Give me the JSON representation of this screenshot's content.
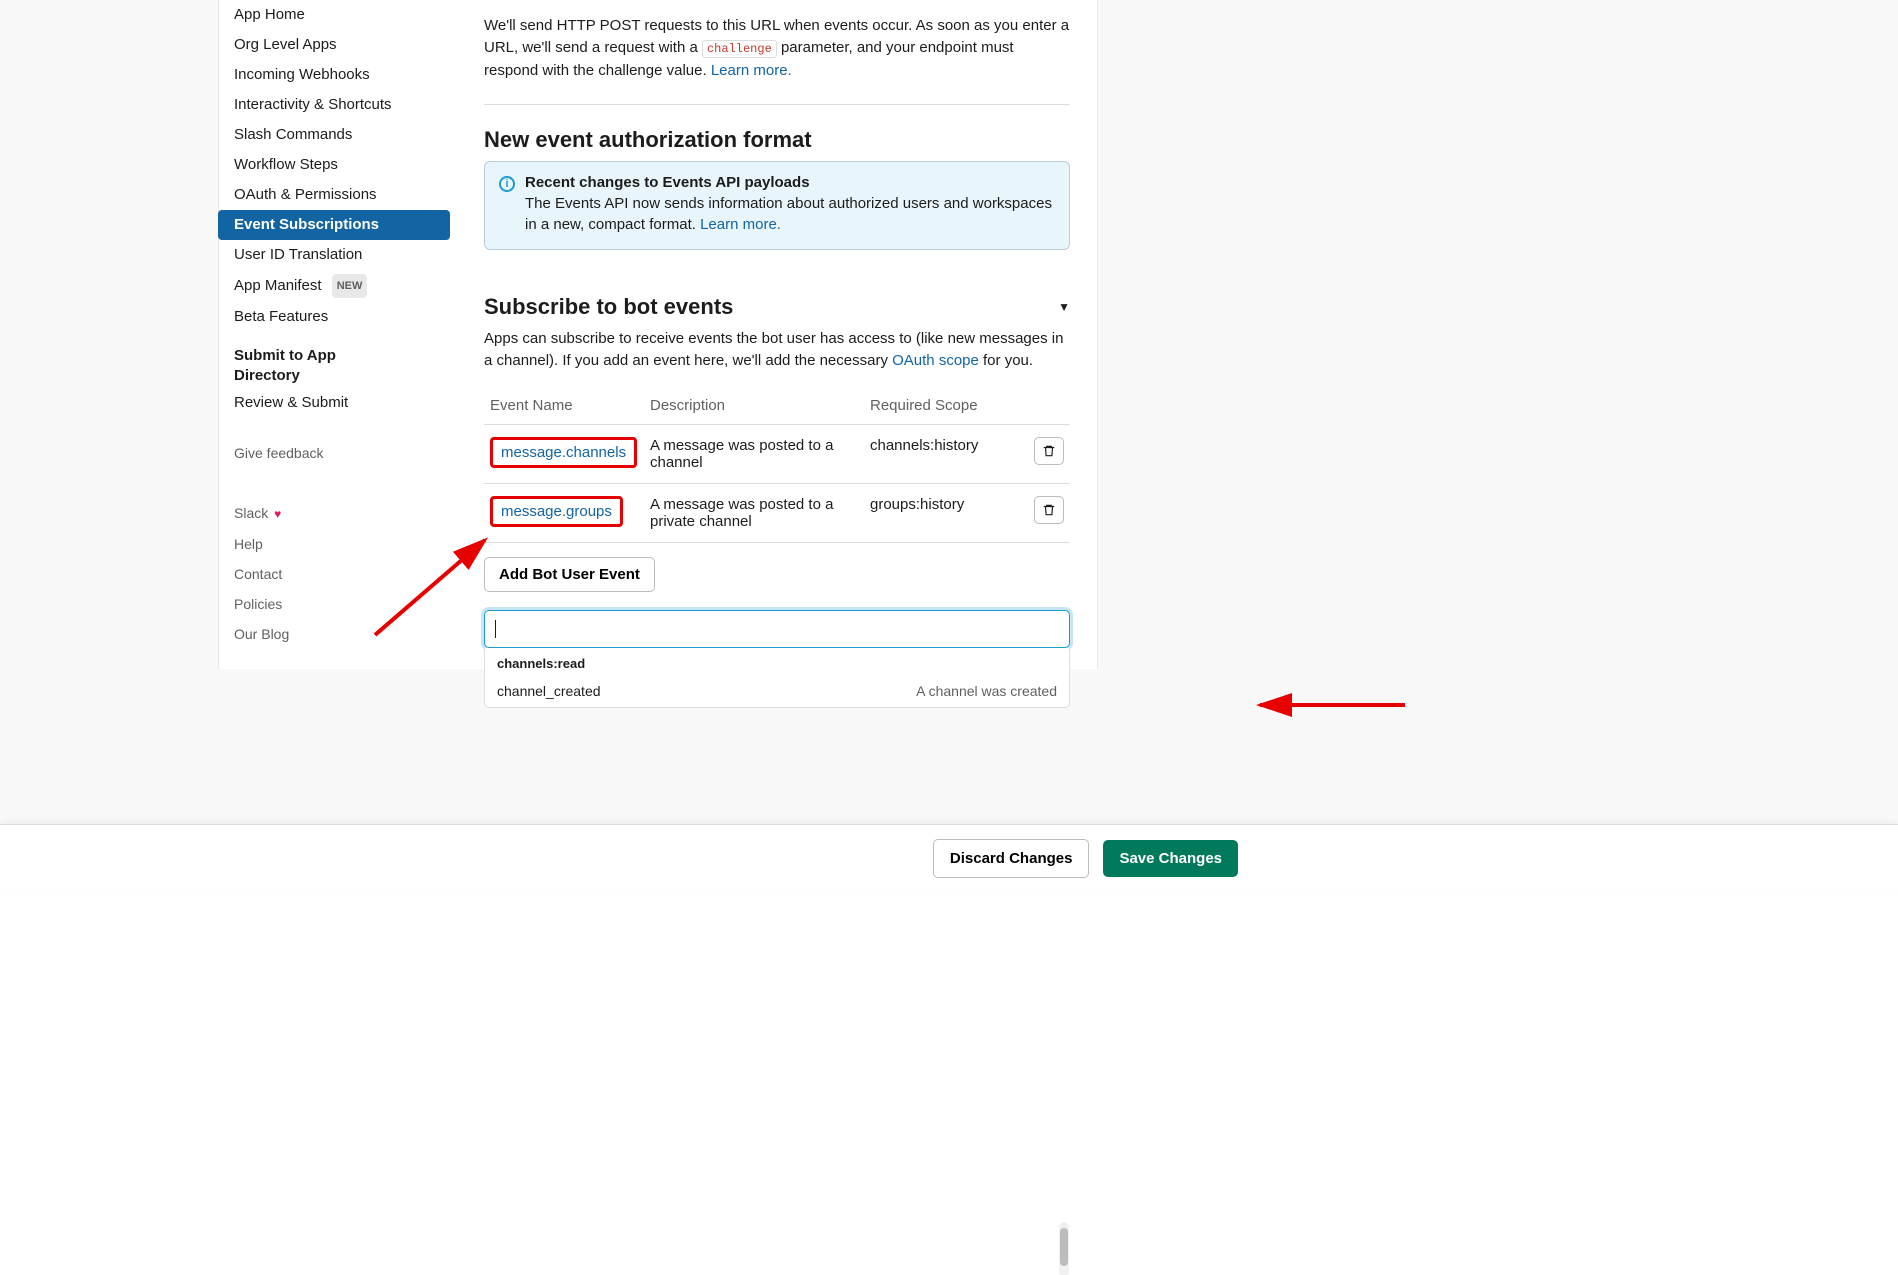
{
  "sidebar": {
    "items": [
      {
        "label": "App Home"
      },
      {
        "label": "Org Level Apps"
      },
      {
        "label": "Incoming Webhooks"
      },
      {
        "label": "Interactivity & Shortcuts"
      },
      {
        "label": "Slash Commands"
      },
      {
        "label": "Workflow Steps"
      },
      {
        "label": "OAuth & Permissions"
      },
      {
        "label": "Event Subscriptions"
      },
      {
        "label": "User ID Translation"
      },
      {
        "label": "App Manifest"
      },
      {
        "label": "Beta Features"
      }
    ],
    "new_badge": "NEW",
    "submit_title_line1": "Submit to App",
    "submit_title_line2": "Directory",
    "review_label": "Review & Submit",
    "feedback_label": "Give feedback",
    "footer": [
      {
        "label": "Slack"
      },
      {
        "label": "Help"
      },
      {
        "label": "Contact"
      },
      {
        "label": "Policies"
      },
      {
        "label": "Our Blog"
      }
    ]
  },
  "main": {
    "intro_pre": "We'll send HTTP POST requests to this URL when events occur. As soon as you enter a URL, we'll send a request with a ",
    "intro_code": "challenge",
    "intro_post": " parameter, and your endpoint must respond with the challenge value. ",
    "learn_more": "Learn more",
    "auth_title": "New event authorization format",
    "info_title": "Recent changes to Events API payloads",
    "info_body": "The Events API now sends information about authorized users and workspaces in a new, compact format. ",
    "info_link": "Learn more.",
    "subscribe_title": "Subscribe to bot events",
    "subscribe_desc_pre": "Apps can subscribe to receive events the bot user has access to (like new messages in a channel). If you add an event here, we'll add the necessary ",
    "oauth_scope_link": "OAuth scope",
    "subscribe_desc_post": " for you.",
    "table": {
      "h1": "Event Name",
      "h2": "Description",
      "h3": "Required Scope",
      "rows": [
        {
          "name": "message.channels",
          "desc": "A message was posted to a channel",
          "scope": "channels:history"
        },
        {
          "name": "message.groups",
          "desc": "A message was posted to a private channel",
          "scope": "groups:history"
        }
      ]
    },
    "add_btn": "Add Bot User Event",
    "dropdown": {
      "header": "channels:read",
      "row_name": "channel_created",
      "row_desc": "A channel was created"
    }
  },
  "footer": {
    "discard": "Discard Changes",
    "save": "Save Changes"
  }
}
